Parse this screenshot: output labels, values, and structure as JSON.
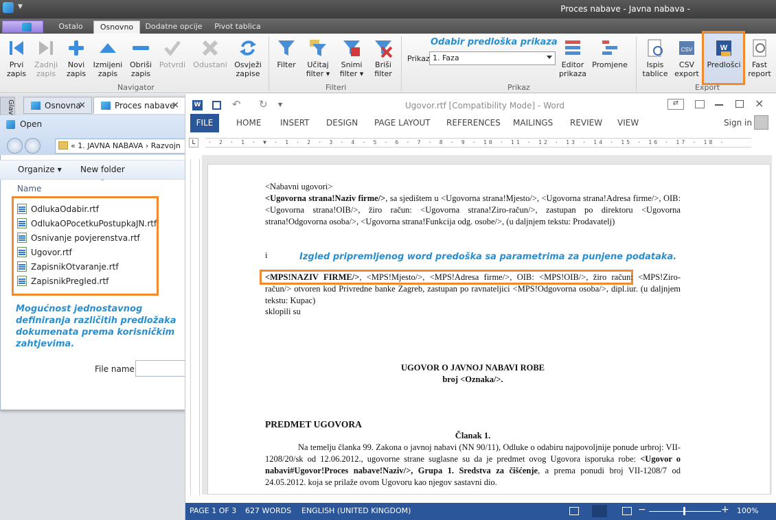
{
  "app": {
    "title": "Proces nabave - Javna nabava -"
  },
  "ribbon_tabs": [
    "Ostalo",
    "Osnovno",
    "Dodatne opcije",
    "Pivot tablica"
  ],
  "navigator": {
    "group_label": "Navigator",
    "buttons": [
      {
        "label": "Prvi\nzapis"
      },
      {
        "label": "Zadnji\nzapis"
      },
      {
        "label": "Novi\nzapis"
      },
      {
        "label": "Izmijeni\nzapis"
      },
      {
        "label": "Obriši\nzapis"
      },
      {
        "label": "Potvrdi"
      },
      {
        "label": "Odustani"
      },
      {
        "label": "Osvježi\nzapise"
      }
    ]
  },
  "filteri": {
    "group_label": "Filteri",
    "buttons": [
      {
        "label": "Filter"
      },
      {
        "label": "Učitaj\nfilter ▾"
      },
      {
        "label": "Snimi\nfilter ▾"
      },
      {
        "label": "Briši\nfilter"
      }
    ]
  },
  "prikaz": {
    "group_label": "Prikaz",
    "hint": "Odabir predloška prikaza",
    "label": "Prikaz",
    "selected": "1. Faza",
    "buttons": [
      {
        "label": "Editor\nprikaza"
      },
      {
        "label": "Promjene"
      }
    ]
  },
  "export": {
    "group_label": "Export",
    "buttons": [
      {
        "label": "Ispis\ntablice"
      },
      {
        "label": "CSV\nexport"
      },
      {
        "label": "Predlošci"
      },
      {
        "label": "Fast\nreport"
      }
    ]
  },
  "doc_tabs": {
    "side": "Glav",
    "tabs": [
      {
        "label": "Osnovna"
      },
      {
        "label": "Proces nabave"
      }
    ]
  },
  "open_dialog": {
    "title": "Open",
    "path": "«  1. JAVNA NABAVA › Razvojn",
    "organize": "Organize ▾",
    "new_folder": "New folder",
    "column_name": "Name",
    "files": [
      "OdlukaOdabir.rtf",
      "OdlukaOPocetkuPostupkaJN.rtf",
      "Osnivanje povjerenstva.rtf",
      "Ugovor.rtf",
      "ZapisnikOtvaranje.rtf",
      "ZapisnikPregled.rtf"
    ],
    "annotation": "Mogućnost jednostavnog definiranja različitih predložaka dokumenata prema korisničkim zahtjevima.",
    "file_name_label": "File name:"
  },
  "word": {
    "title": "Ugovor.rtf [Compatibility Mode] - Word",
    "menu": [
      "FILE",
      "HOME",
      "INSERT",
      "DESIGN",
      "PAGE LAYOUT",
      "REFERENCES",
      "MAILINGS",
      "REVIEW",
      "VIEW"
    ],
    "sign_in": "Sign in",
    "doc": {
      "line1": "<Nabavni ugovori>",
      "para1_bold": "<Ugovorna strana!Naziv firme/>",
      "para1_rest": ", sa sjedištem u <Ugovorna strana!Mjesto/>, <Ugovorna strana!Adresa firme/>, OIB: <Ugovorna strana!OIB/>, žiro račun: <Ugovorna strana!Ziro-račun/>, zastupan po direktoru <Ugovorna strana!Odgovorna osoba/>, <Ugovorna strana!Funkcija odg. osobe/>, (u daljnjem tekstu: Prodavatelj)",
      "and": "i",
      "annotation": "Izgled pripremljenog word predoška sa parametrima za punjene podataka.",
      "para2_bold": "<MPS!NAZIV FIRME/>",
      "para2_rest": ", <MPS!Mjesto/>, <MPS!Adresa firme/>, OIB: <MPS!OIB/>, žiro račun: <MPS!Ziro-račun/> otvoren kod Privredne banke Zagreb, zastupan po ravnatelјici <MPS!Odgovorna osoba/>, dipl.iur. (u daljnjem tekstu: Kupac)",
      "sklopili": "sklopili su",
      "heading1": "UGOVOR O JAVNOJ NABAVI ROBE",
      "heading2": "broj <Oznaka/>.",
      "section": "PREDMET UGOVORA",
      "clanak": "Članak 1.",
      "para3_a": "Na temelju članka 99. Zakona o javnoj nabavi (NN 90/11), Odluke o odabiru najpovoljnije ponude urbroj: VII-1208/20/sk od 12.06.2012., ugovorne strane suglasne su da je predmet ovog Ugovora isporuka robe: ",
      "para3_b": "<Ugovor o nabavi#Ugovor!Proces nabave!Naziv/>, Grupa 1. Sredstva za čišćenje",
      "para3_c": ", a prema ponudi broj VII-1208/7 od 24.05.2012. koja se prilaže ovom Ugovoru kao njegov sastavni dio."
    },
    "status": {
      "page": "PAGE 1 OF 3",
      "words": "627 WORDS",
      "language": "ENGLISH (UNITED KINGDOM)",
      "zoom": "100%"
    },
    "ruler_marks": "· 2 · 1 · ▼ · 1 · 2 · 3 · 4 · 5 · 6 · 7 · 8 · 9 · 10 · 11 · 12 · 13 · 14 · 15 · 16 · 17 · 18 ·"
  }
}
